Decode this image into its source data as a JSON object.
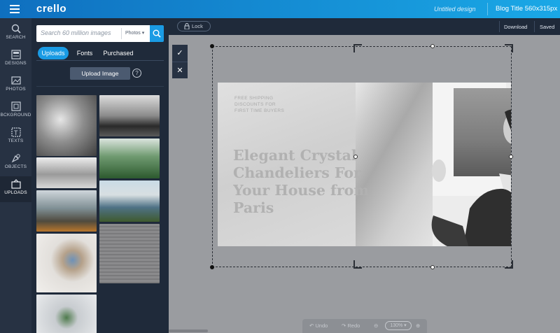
{
  "app": {
    "logo": "crello",
    "document_name": "Untitled design",
    "document_size": "Blog Title 560x315px"
  },
  "rail": [
    {
      "label": "SEARCH",
      "icon": "search-icon"
    },
    {
      "label": "DESIGNS",
      "icon": "designs-icon"
    },
    {
      "label": "PHOTOS",
      "icon": "photos-icon"
    },
    {
      "label": "BCKGROUND",
      "icon": "background-icon"
    },
    {
      "label": "TEXTS",
      "icon": "texts-icon"
    },
    {
      "label": "OBJECTS",
      "icon": "objects-icon"
    },
    {
      "label": "UPLOADS",
      "icon": "uploads-icon",
      "active": true
    }
  ],
  "panel": {
    "search_placeholder": "Search 60 million images",
    "search_filter": "Photos",
    "tabs": [
      "Uploads",
      "Fonts",
      "Purchased"
    ],
    "upload_button": "Upload Image",
    "help": "?"
  },
  "toolbar": {
    "lock": "Lock",
    "download": "Download",
    "saved": "Saved"
  },
  "design": {
    "promo_lines": [
      "FREE SHIPPING",
      "DISCOUNTS FOR",
      "FIRST TIME BUYERS"
    ],
    "headline_lines": [
      "Elegant Crystal",
      "Chandeliers For",
      "Your House from",
      "Paris"
    ]
  },
  "bottom": {
    "undo": "Undo",
    "redo": "Redo",
    "zoom": "130%"
  },
  "colors": {
    "accent": "#1a9be4",
    "rail": "#273243",
    "panel": "#1f2a3a",
    "canvas": "#9a9ca0"
  }
}
